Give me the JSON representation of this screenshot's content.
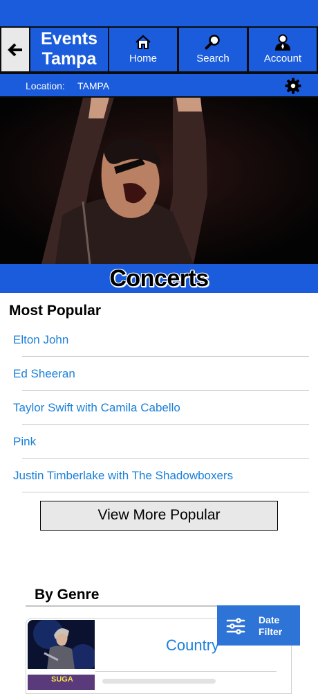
{
  "header": {
    "brand_line1": "Events",
    "brand_line2": "Tampa",
    "nav": [
      {
        "label": "Home",
        "icon": "home-icon"
      },
      {
        "label": "Search",
        "icon": "search-icon"
      },
      {
        "label": "Account",
        "icon": "user-icon"
      }
    ]
  },
  "location": {
    "label": "Location:",
    "value": "TAMPA"
  },
  "hero": {
    "title": "Concerts"
  },
  "most_popular": {
    "heading": "Most Popular",
    "items": [
      "Elton John",
      "Ed Sheeran",
      "Taylor Swift with Camila Cabello",
      "Pink",
      "Justin Timberlake with The Shadowboxers"
    ],
    "more_label": "View More Popular"
  },
  "by_genre": {
    "heading": "By Genre",
    "items": [
      {
        "label": "Country"
      }
    ],
    "thumb2_text": "SUGA"
  },
  "date_filter": {
    "line1": "Date",
    "line2": "Filter"
  },
  "colors": {
    "primary": "#1a5cdb",
    "link": "#1a7fd9",
    "fab": "#2e74d6"
  }
}
